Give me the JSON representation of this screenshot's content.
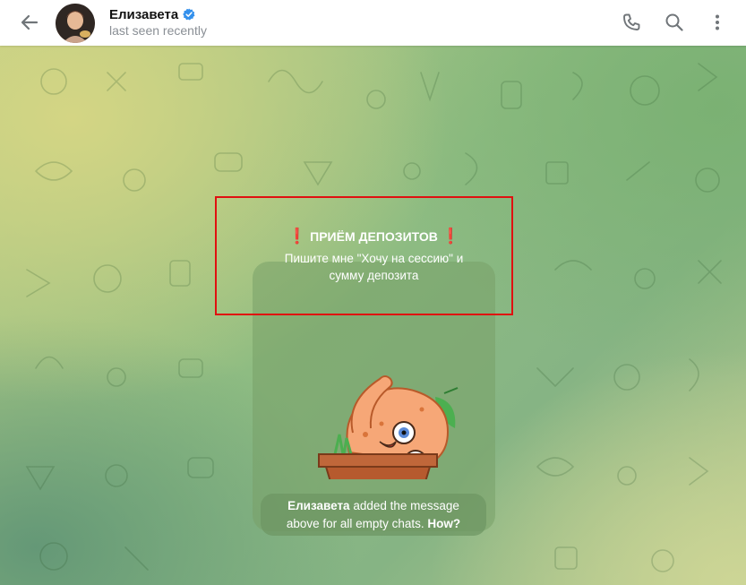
{
  "header": {
    "contact_name": "Елизавета",
    "status": "last seen recently",
    "icons": {
      "back": "back-arrow-icon",
      "verified": "verified-badge-icon",
      "call": "phone-icon",
      "search": "search-icon",
      "menu": "more-vertical-icon"
    },
    "verified_color": "#3390ec"
  },
  "message": {
    "title": "ПРИЁМ ДЕПОЗИТОВ",
    "excl_left": "❗",
    "excl_right": "❗",
    "line1": "Пишите мне \"Хочу на сессию\" и",
    "line2": "сумму депозита",
    "sticker": "potato-in-pot-sticker"
  },
  "service": {
    "name": "Елизавета",
    "text_line1": " added the message",
    "text_line2": "above for all empty chats. ",
    "link": "How?"
  },
  "colors": {
    "highlight_border": "#e01010",
    "exclamation": "#e53935"
  }
}
